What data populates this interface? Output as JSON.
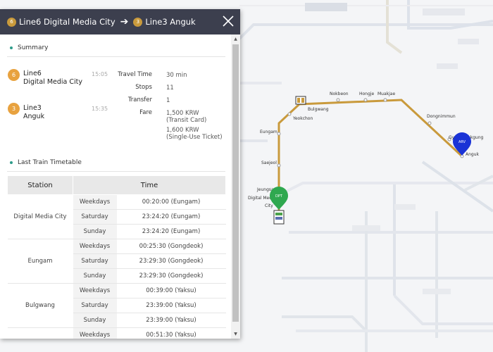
{
  "header": {
    "origin_line_num": "6",
    "origin_label": "Line6 Digital Media City",
    "dest_line_num": "3",
    "dest_label": "Line3 Anguk",
    "arrow": "➔"
  },
  "summary": {
    "title": "Summary",
    "origin": {
      "badge": "6",
      "line": "Line6",
      "station": "Digital Media City",
      "time": "15:05"
    },
    "dest": {
      "badge": "3",
      "line": "Line3",
      "station": "Anguk",
      "time": "15:35"
    },
    "travel_time_label": "Travel Time",
    "travel_time_value": "30 min",
    "stops_label": "Stops",
    "stops_value": "11",
    "transfer_label": "Transfer",
    "transfer_value": "1",
    "fare_label": "Fare",
    "fare_card_amount": "1,500 KRW",
    "fare_card_type": "(Transit Card)",
    "fare_ticket_amount": "1,600 KRW",
    "fare_ticket_type": "(Single-Use Ticket)"
  },
  "last_train": {
    "title": "Last Train Timetable",
    "columns": [
      "Station",
      "Time"
    ],
    "rows": [
      {
        "station": "Digital Media City",
        "entries": [
          {
            "day": "Weekdays",
            "time": "00:20:00 (Eungam)"
          },
          {
            "day": "Saturday",
            "time": "23:24:20 (Eungam)"
          },
          {
            "day": "Sunday",
            "time": "23:24:20 (Eungam)"
          }
        ]
      },
      {
        "station": "Eungam",
        "entries": [
          {
            "day": "Weekdays",
            "time": "00:25:30 (Gongdeok)"
          },
          {
            "day": "Saturday",
            "time": "23:29:30 (Gongdeok)"
          },
          {
            "day": "Sunday",
            "time": "23:29:30 (Gongdeok)"
          }
        ]
      },
      {
        "station": "Bulgwang",
        "entries": [
          {
            "day": "Weekdays",
            "time": "00:39:00 (Yaksu)"
          },
          {
            "day": "Saturday",
            "time": "23:39:00 (Yaksu)"
          },
          {
            "day": "Sunday",
            "time": "23:39:00 (Yaksu)"
          }
        ]
      },
      {
        "station": "",
        "entries": [
          {
            "day": "Weekdays",
            "time": "00:51:30 (Yaksu)"
          }
        ]
      }
    ]
  },
  "map": {
    "route_color": "#c99a3c",
    "dpt_marker_label": "DPT",
    "arv_marker_label": "ARV",
    "stations": {
      "jeungsan": "Jeungsan",
      "dmc_1": "Digital Media",
      "dmc_2": "City",
      "saejeol": "Saejeol",
      "eungam": "Eungam",
      "yeokchon": "Yeokchon",
      "bulgwang": "Bulgwang",
      "nokbeon": "Nokbeon",
      "hongje": "Hongje",
      "muakjae": "Muakjae",
      "dongnimmun": "Dongnimmun",
      "gyeongbokgung": "Gyeongbokgung",
      "anguk": "Anguk"
    }
  }
}
